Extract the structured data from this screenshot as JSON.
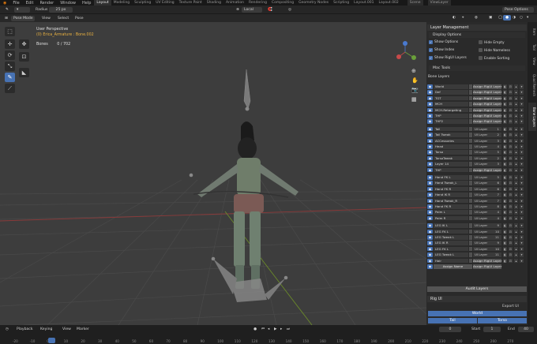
{
  "topbar": {
    "menus": [
      "File",
      "Edit",
      "Render",
      "Window",
      "Help"
    ],
    "workspaces": [
      "Layout",
      "Modeling",
      "Sculpting",
      "UV Editing",
      "Texture Paint",
      "Shading",
      "Animation",
      "Rendering",
      "Compositing",
      "Geometry Nodes",
      "Scripting",
      "Layout.001",
      "Layout.002"
    ],
    "active_workspace": "Layout",
    "scene": "Scene",
    "view_layer": "ViewLayer"
  },
  "toolheader": {
    "radius_label": "Radius",
    "radius_value": "25 px",
    "orientation": "Local",
    "pose_options": "Pose Options"
  },
  "viewportheader": {
    "mode": "Pose Mode",
    "menus": [
      "View",
      "Select",
      "Pose"
    ]
  },
  "overlay": {
    "view_name": "User Perspective",
    "object": "(0) Erica_Armature : Bone.002",
    "bones_label": "Bones",
    "bones_value": "0 / 702"
  },
  "npanel": {
    "tabs": [
      "Item",
      "Tool",
      "View",
      "Quad Remesh",
      "Bone Layers"
    ],
    "active_tab": "Bone Layers",
    "layer_management": "Layer Management",
    "display_options": "Display Options",
    "options": [
      {
        "label": "Show Options",
        "checked": true
      },
      {
        "label": "Hide Empty",
        "checked": false
      },
      {
        "label": "Show Index",
        "checked": true
      },
      {
        "label": "Hide Nameless",
        "checked": false
      },
      {
        "label": "Show RigUI Layers",
        "checked": true
      },
      {
        "label": "Enable Sorting",
        "checked": false
      }
    ],
    "mac_tools": "Mac Tools",
    "bone_layers_label": "Bone Layers",
    "assign_rigui_label": "Assign RigUI Layer",
    "uilayer_label": "UI Layer",
    "assign_name_label": "Assign Name",
    "groups": [
      [
        [
          "World",
          null
        ],
        [
          "Def",
          null
        ],
        [
          "TGT",
          null
        ],
        [
          "MCH",
          null
        ],
        [
          "MCH-Retargeting",
          null
        ],
        [
          "THP",
          null
        ],
        [
          "THP2",
          null
        ]
      ],
      [
        [
          "Tail",
          "1"
        ],
        [
          "Tail Tweak",
          "2"
        ],
        [
          "ACCessories",
          "3"
        ],
        [
          "Head",
          "4"
        ],
        [
          "Torso",
          "5"
        ],
        [
          "TorsoTweak",
          "2"
        ],
        [
          "Layer 14",
          "3"
        ],
        [
          "THP",
          null
        ]
      ],
      [
        [
          "Hand FK L",
          "5"
        ],
        [
          "Hand Tweak_L",
          "6"
        ],
        [
          "Hand FK R",
          "6"
        ],
        [
          "Hand IK R",
          "7"
        ],
        [
          "Hand Tweak_R",
          "7"
        ],
        [
          "Hand FK R",
          "8"
        ],
        [
          "Palm L",
          "4"
        ],
        [
          "Palm R",
          "4"
        ]
      ],
      [
        [
          "LEG IK L",
          "9"
        ],
        [
          "LEG FK L",
          "10"
        ],
        [
          "LEG Tweak L",
          "11"
        ],
        [
          "LEG IK R",
          "9"
        ],
        [
          "LEG FK L",
          "10"
        ],
        [
          "LEG Tweak L",
          "11"
        ],
        [
          "Hair",
          null
        ]
      ]
    ],
    "audit_layers": "Audit Layers",
    "rig_ui": "Rig UI",
    "export_ui": "Export UI",
    "rig_buttons": {
      "world": "World",
      "tail": "Tail",
      "torso": "Torso"
    }
  },
  "timeline": {
    "menus": [
      "Playback",
      "Keying",
      "View",
      "Marker"
    ],
    "current_frame": "0",
    "start_label": "Start",
    "start": "1",
    "end_label": "End",
    "end": "40",
    "ticks": [
      "-20",
      "-10",
      "0",
      "10",
      "20",
      "30",
      "40",
      "50",
      "60",
      "70",
      "80",
      "90",
      "100",
      "110",
      "120",
      "130",
      "140",
      "150",
      "160",
      "170",
      "180",
      "190",
      "200",
      "210",
      "220",
      "230",
      "240",
      "250",
      "260",
      "270"
    ]
  },
  "colors": {
    "accent": "#4772b3",
    "viewport": "#3d3d3d",
    "panel": "#2a2a2a"
  }
}
